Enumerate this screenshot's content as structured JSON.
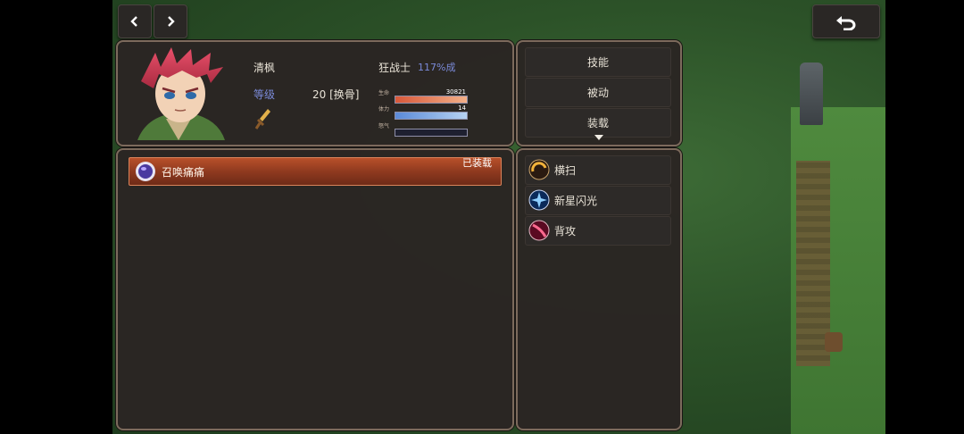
{
  "character": {
    "name": "清枫",
    "class_text": "狂战士",
    "exp_text": "117%成",
    "level_label": "等级",
    "level_value": "20 [换骨]"
  },
  "bars": [
    {
      "label": "生命",
      "value": "30821",
      "fill": 1.0,
      "color": "#e86a4a"
    },
    {
      "label": "体力",
      "value": "14",
      "fill": 1.0,
      "color": "#6c9be0"
    },
    {
      "label": "怒气",
      "value": "",
      "fill": 0.0,
      "color": "#6c6ca0"
    }
  ],
  "menu": {
    "items": [
      "技能",
      "被动",
      "装载"
    ],
    "more_icon": "caret-down-icon"
  },
  "equipped": {
    "badge": "已装载",
    "item_name": "召唤痛痛"
  },
  "skills": [
    {
      "name": "横扫",
      "icon": "swirl-icon",
      "color": "#e2a23a"
    },
    {
      "name": "新星闪光",
      "icon": "star-burst-icon",
      "color": "#4aa8ff"
    },
    {
      "name": "背攻",
      "icon": "slash-icon",
      "color": "#e0426a"
    }
  ],
  "nav": {
    "prev_icon": "chevron-left-icon",
    "next_icon": "chevron-right-icon",
    "back_icon": "undo-arrow-icon"
  }
}
